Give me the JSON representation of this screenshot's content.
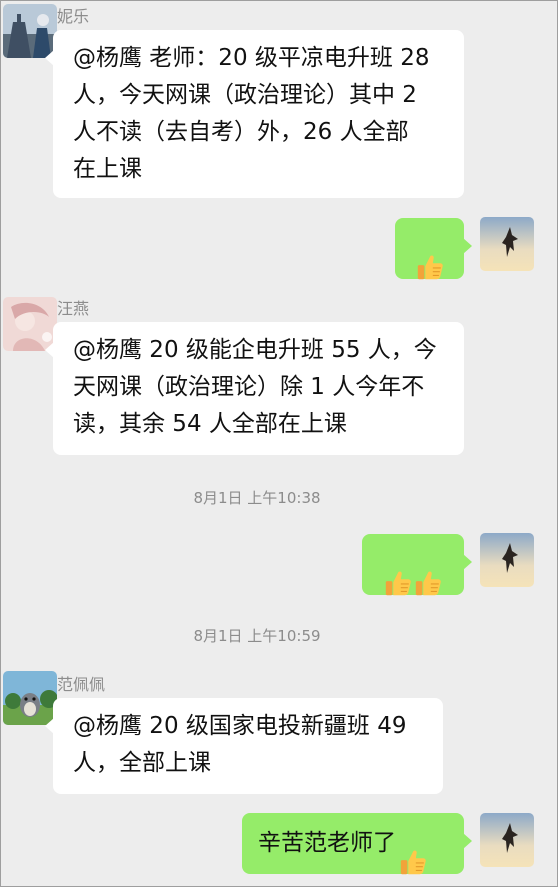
{
  "chat": {
    "messages": [
      {
        "sender": "妮乐",
        "text": "@杨鹰  老师：20 级平凉电升班 28\n人，今天网课（政治理论）其中 2\n人不读（去自考）外，26 人全部\n在上课"
      },
      {
        "reply": "thumbs-up"
      },
      {
        "sender": "汪燕",
        "text": "@杨鹰 20 级能企电升班 55 人，今\n天网课（政治理论）除 1 人今年不\n读，其余 54 人全部在上课"
      },
      {
        "timestamp": "8月1日 上午10:38"
      },
      {
        "reply": "thumbs-up x2"
      },
      {
        "timestamp": "8月1日 上午10:59"
      },
      {
        "sender": "范佩佩",
        "text": "@杨鹰  20 级国家电投新疆班 49\n人，全部上课"
      },
      {
        "reply_text": "辛苦范老师了"
      }
    ]
  },
  "icons": {
    "thumbs_up": "thumbs-up-emoji",
    "self_avatar": "eagle-sky-avatar"
  },
  "colors": {
    "background": "#ededed",
    "bubble_in": "#ffffff",
    "bubble_out": "#95ec69",
    "meta_text": "#8c8c8c"
  }
}
